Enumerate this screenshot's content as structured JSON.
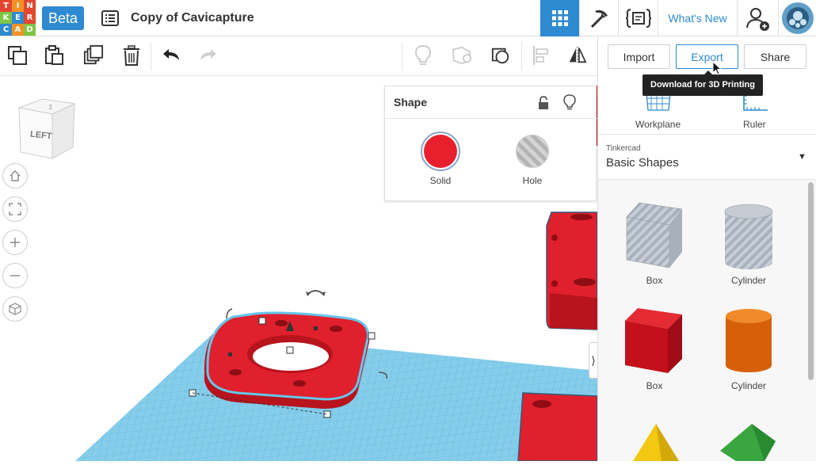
{
  "topbar": {
    "logo_letters": [
      "T",
      "I",
      "N",
      "K",
      "E",
      "R",
      "C",
      "A",
      "D"
    ],
    "logo_colors": [
      "#e2462f",
      "#f39222",
      "#e2462f",
      "#7ec544",
      "#2e8ad1",
      "#e2462f",
      "#2e8ad1",
      "#f39222",
      "#7ec544"
    ],
    "beta_label": "Beta",
    "design_title": "Copy of Cavicapture",
    "whats_new": "What's New",
    "accent_color": "#2e8ad1"
  },
  "toolbar": {
    "icons": [
      "copy-icon",
      "paste-icon",
      "duplicate-icon",
      "delete-icon",
      "undo-icon",
      "redo-icon",
      "show-hints-icon",
      "notes-icon",
      "group-icon",
      "align-icon",
      "mirror-icon"
    ]
  },
  "right_panel": {
    "import_label": "Import",
    "export_label": "Export",
    "share_label": "Share",
    "tooltip": "Download for 3D Printing",
    "workplane_label": "Workplane",
    "ruler_label": "Ruler",
    "library_owner": "Tinkercad",
    "library_name": "Basic Shapes",
    "shapes": [
      {
        "label": "Box",
        "style": "hole"
      },
      {
        "label": "Cylinder",
        "style": "hole"
      },
      {
        "label": "Box",
        "color": "#d0111b"
      },
      {
        "label": "Cylinder",
        "color": "#e6720f"
      }
    ]
  },
  "inspector": {
    "title": "Shape",
    "solid_label": "Solid",
    "hole_label": "Hole",
    "solid_color": "#e8202d"
  },
  "viewcube": {
    "face_label": "LEFT"
  }
}
